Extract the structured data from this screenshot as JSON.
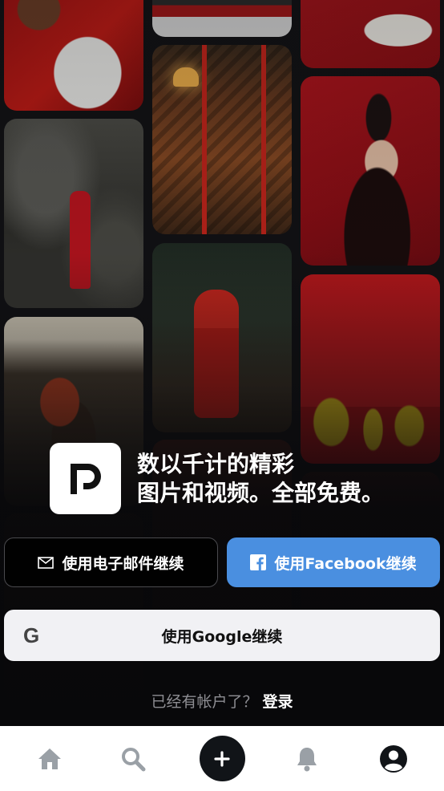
{
  "brand": {
    "tagline_line1": "数以千计的精彩",
    "tagline_line2": "图片和视频。全部免费。"
  },
  "auth": {
    "email_button_label": "使用电子邮件继续",
    "facebook_button_label": "使用Facebook继续",
    "google_button_label": "使用Google继续",
    "google_icon_glyph": "G",
    "has_account_prompt": "已经有帐户了？",
    "login_label": "登录"
  },
  "nav": {
    "items": [
      {
        "icon": "home-icon"
      },
      {
        "icon": "search-icon"
      },
      {
        "icon": "plus-icon"
      },
      {
        "icon": "bell-icon"
      },
      {
        "icon": "profile-icon"
      }
    ]
  },
  "colors": {
    "facebook_blue": "#4a8fe0",
    "google_button_bg": "#f1f1f4",
    "nav_icon_gray": "#9aa0a6",
    "create_button": "#111418"
  }
}
